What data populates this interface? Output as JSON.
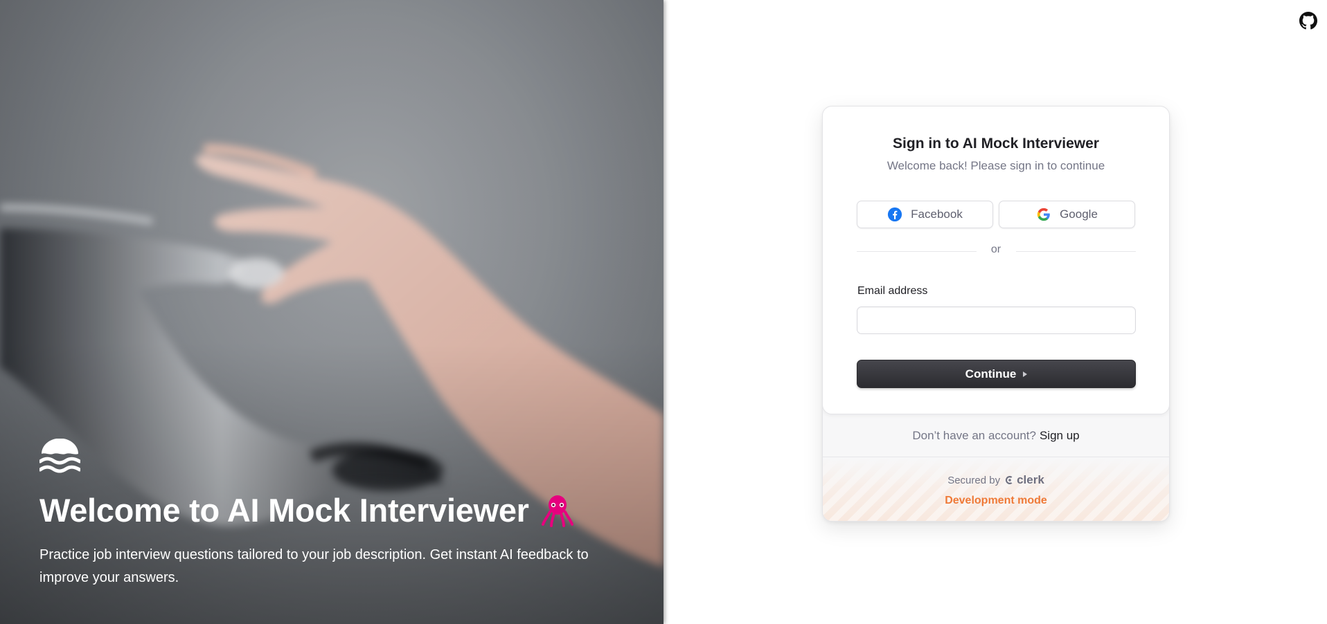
{
  "hero": {
    "title": "Welcome to AI Mock Interviewer",
    "subtitle": "Practice job interview questions tailored to your job description. Get instant AI feedback to improve your answers.",
    "logo_icon": "waves-logo-icon",
    "emoji_icon": "octopus-icon",
    "emoji_color": "#e6007e"
  },
  "header": {
    "github_icon": "github-icon"
  },
  "signin": {
    "title": "Sign in to AI Mock Interviewer",
    "subtitle": "Welcome back! Please sign in to continue",
    "facebook_label": "Facebook",
    "google_label": "Google",
    "divider_text": "or",
    "email_label": "Email address",
    "email_value": "",
    "email_placeholder": "",
    "continue_label": "Continue",
    "no_account_text": "Don’t have an account?",
    "signup_label": "Sign up",
    "secured_by": "Secured by",
    "clerk_brand": "clerk",
    "dev_mode": "Development mode",
    "accent_color": "#ef7a38",
    "button_color": "#2f2f34"
  }
}
